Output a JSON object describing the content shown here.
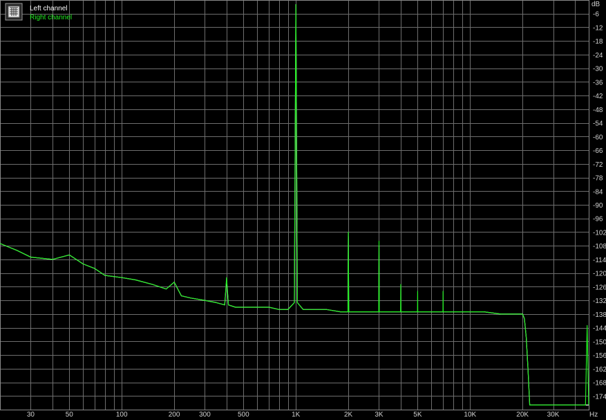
{
  "chart_data": {
    "type": "line",
    "title": "",
    "xscale": "log",
    "xlim": [
      20,
      48000
    ],
    "ylim": [
      -180,
      0
    ],
    "grid": true,
    "legend_placement": "top-left",
    "x_unit": "Hz",
    "y_unit": "dB",
    "x_ticks": [
      {
        "value": 30,
        "label": "30"
      },
      {
        "value": 50,
        "label": "50"
      },
      {
        "value": 100,
        "label": "100"
      },
      {
        "value": 200,
        "label": "200"
      },
      {
        "value": 300,
        "label": "300"
      },
      {
        "value": 500,
        "label": "500"
      },
      {
        "value": 1000,
        "label": "1K"
      },
      {
        "value": 2000,
        "label": "2K"
      },
      {
        "value": 3000,
        "label": "3K"
      },
      {
        "value": 5000,
        "label": "5K"
      },
      {
        "value": 10000,
        "label": "10K"
      },
      {
        "value": 20000,
        "label": "20K"
      },
      {
        "value": 30000,
        "label": "30K"
      }
    ],
    "y_ticks": [
      -6,
      -12,
      -18,
      -24,
      -30,
      -36,
      -42,
      -48,
      -54,
      -60,
      -66,
      -72,
      -78,
      -84,
      -90,
      -96,
      -102,
      -108,
      -114,
      -120,
      -126,
      -132,
      -138,
      -144,
      -150,
      -156,
      -162,
      -168,
      -174
    ],
    "series": [
      {
        "name": "Left channel",
        "color": "#ffffff",
        "x": [
          20,
          25,
          30,
          40,
          50,
          60,
          70,
          80,
          100,
          120,
          150,
          180,
          200,
          220,
          250,
          300,
          350,
          390,
          400,
          410,
          450,
          500,
          600,
          700,
          800,
          900,
          980,
          1000,
          1020,
          1100,
          1300,
          1500,
          1800,
          1990,
          2000,
          2010,
          2500,
          2990,
          3000,
          3010,
          3500,
          4000,
          5000,
          6000,
          7000,
          8000,
          9000,
          10000,
          12000,
          15000,
          18000,
          19000,
          20000,
          20500,
          21000,
          21500,
          22000,
          24000,
          26000,
          28000,
          30000,
          32000,
          35000,
          38000,
          40000,
          42000,
          44000,
          46000,
          48000
        ],
        "y": [
          -107,
          -110,
          -113,
          -114,
          -112,
          -116,
          -118,
          -121,
          -122,
          -123,
          -125,
          -127,
          -124,
          -130,
          -131,
          -132,
          -133,
          -134,
          -123,
          -134,
          -135,
          -135,
          -135,
          -135,
          -136,
          -136,
          -133,
          -2,
          -133,
          -136,
          -136,
          -136,
          -137,
          -137,
          -104,
          -137,
          -137,
          -137,
          -108,
          -137,
          -137,
          -137,
          -137,
          -137,
          -137,
          -137,
          -137,
          -137,
          -137,
          -138,
          -138,
          -138,
          -138,
          -140,
          -148,
          -162,
          -178,
          -178,
          -178,
          -178,
          -178,
          -178,
          -178,
          -178,
          -178,
          -178,
          -178,
          -178,
          -178
        ]
      },
      {
        "name": "Right channel",
        "color": "#22ee22",
        "x": [
          20,
          25,
          30,
          40,
          50,
          60,
          70,
          80,
          100,
          120,
          150,
          180,
          200,
          220,
          250,
          300,
          350,
          390,
          400,
          410,
          450,
          500,
          600,
          700,
          800,
          900,
          980,
          1000,
          1020,
          1100,
          1300,
          1500,
          1800,
          1990,
          2000,
          2010,
          2500,
          2990,
          3000,
          3010,
          3500,
          3990,
          4000,
          4010,
          4500,
          4990,
          5000,
          5010,
          6000,
          6990,
          7000,
          7010,
          8000,
          9000,
          10000,
          12000,
          15000,
          18000,
          19000,
          20000,
          20500,
          21000,
          21500,
          22000,
          24000,
          26000,
          28000,
          30000,
          32000,
          35000,
          38000,
          40000,
          42000,
          44000,
          46000,
          47000,
          48000
        ],
        "y": [
          -107,
          -110,
          -113,
          -114,
          -112,
          -116,
          -118,
          -121,
          -122,
          -123,
          -125,
          -127,
          -124,
          -130,
          -131,
          -132,
          -133,
          -134,
          -122,
          -134,
          -135,
          -135,
          -135,
          -135,
          -136,
          -136,
          -133,
          -2,
          -133,
          -136,
          -136,
          -136,
          -137,
          -137,
          -102,
          -137,
          -137,
          -137,
          -106,
          -137,
          -137,
          -137,
          -125,
          -137,
          -137,
          -137,
          -128,
          -137,
          -137,
          -137,
          -128,
          -137,
          -137,
          -137,
          -137,
          -137,
          -138,
          -138,
          -138,
          -138,
          -140,
          -148,
          -162,
          -178,
          -178,
          -178,
          -178,
          -178,
          -178,
          -178,
          -178,
          -178,
          -178,
          -178,
          -178,
          -143,
          -178
        ]
      }
    ]
  }
}
